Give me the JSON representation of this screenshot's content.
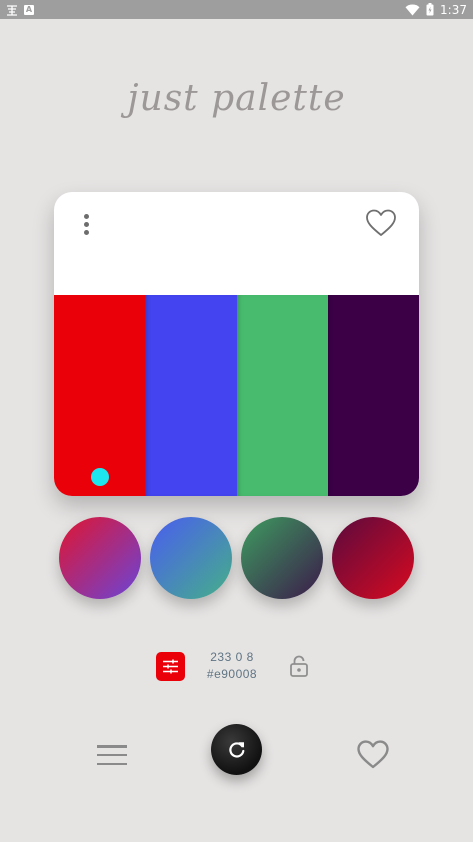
{
  "status_bar": {
    "time": "1:37",
    "icons": [
      "app-notification-icon",
      "a-notification-icon",
      "wifi-icon",
      "battery-icon"
    ]
  },
  "app": {
    "logo_text": "just palette"
  },
  "palette": {
    "swatches": [
      {
        "color": "#e90008",
        "selected": true
      },
      {
        "color": "#4444f0"
      },
      {
        "color": "#48bb6e"
      },
      {
        "color": "#3c0047"
      }
    ],
    "marker_color": "#1ee6ee"
  },
  "gradients": [
    {
      "from": "#e01530",
      "to": "#6a45d8"
    },
    {
      "from": "#4a5cf0",
      "to": "#45b088"
    },
    {
      "from": "#3e9c60",
      "to": "#3b1a4a"
    },
    {
      "from": "#5a0a3e",
      "to": "#d80a20"
    }
  ],
  "selected_color": {
    "rgb": "233 0 8",
    "hex": "#e90008"
  },
  "colors": {
    "background": "#e6e4e3",
    "accent": "#e90008",
    "text_info": "#5f7484"
  }
}
